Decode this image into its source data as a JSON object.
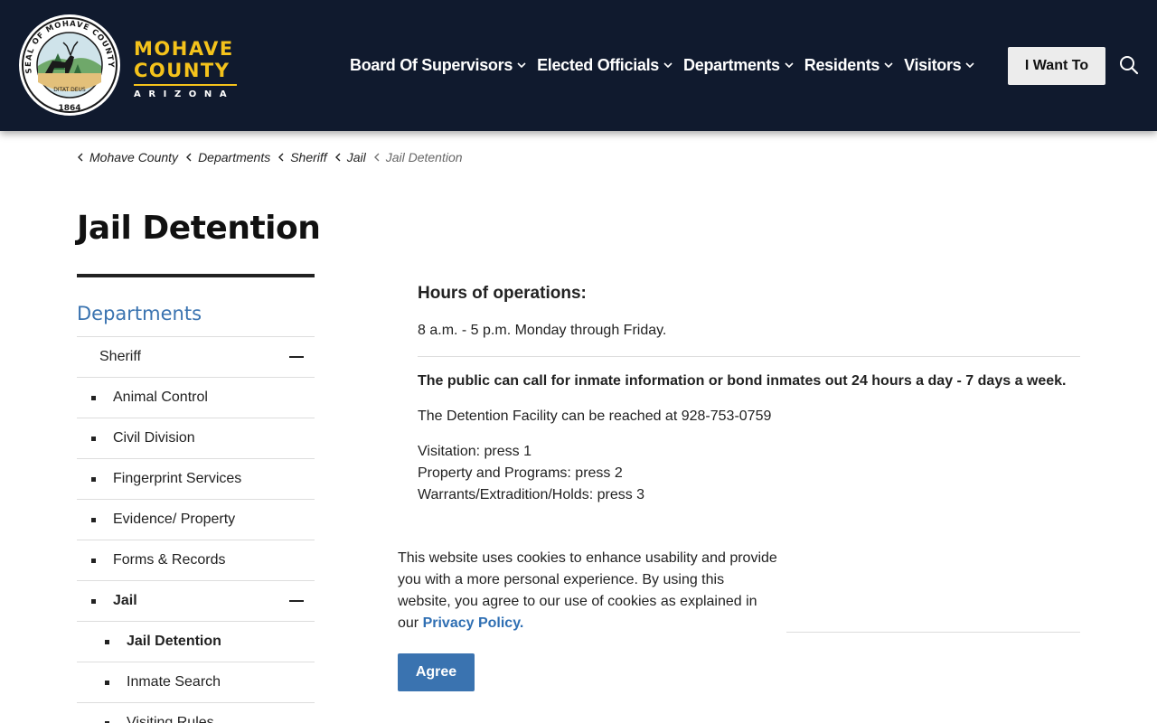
{
  "header": {
    "logo": {
      "seal_ring_text": "SEAL OF MOHAVE COUNTY ARIZONA",
      "seal_motto": "DITAT DEUS",
      "seal_year": "1864",
      "line1": "MOHAVE",
      "line2": "COUNTY",
      "line3": "ARIZONA"
    },
    "nav": [
      {
        "label": "Board Of Supervisors"
      },
      {
        "label": "Elected Officials"
      },
      {
        "label": "Departments"
      },
      {
        "label": "Residents"
      },
      {
        "label": "Visitors"
      }
    ],
    "i_want_to": "I Want To",
    "colors": {
      "header_bg": "#101a2e",
      "brand_gold": "#f4c21b",
      "link_blue": "#3a73b0"
    }
  },
  "breadcrumb": [
    {
      "label": "Mohave County"
    },
    {
      "label": "Departments"
    },
    {
      "label": "Sheriff"
    },
    {
      "label": "Jail"
    },
    {
      "label": "Jail Detention",
      "current": true
    }
  ],
  "page_title": "Jail Detention",
  "sidebar": {
    "heading": "Departments",
    "items": [
      {
        "label": "Sheriff",
        "level": 0,
        "expanded": true
      },
      {
        "label": "Animal Control",
        "level": 1
      },
      {
        "label": "Civil Division",
        "level": 1
      },
      {
        "label": "Fingerprint Services",
        "level": 1
      },
      {
        "label": "Evidence/ Property",
        "level": 1
      },
      {
        "label": "Forms & Records",
        "level": 1
      },
      {
        "label": "Jail",
        "level": 1,
        "expanded": true,
        "active": true
      },
      {
        "label": "Jail Detention",
        "level": 2,
        "active": true
      },
      {
        "label": "Inmate Search",
        "level": 2
      },
      {
        "label": "Visiting Rules",
        "level": 2
      }
    ]
  },
  "content": {
    "hours_title": "Hours of operations:",
    "hours_text": "8 a.m. - 5 p.m. Monday through Friday.",
    "bold_notice": "The public can call for inmate information or bond inmates out 24 hours a day - 7 days a week.",
    "reach_text": "The Detention Facility can be reached at 928-753-0759",
    "options": [
      "Visitation: press 1",
      "Property and Programs: press 2",
      "Warrants/Extradition/Holds: press 3"
    ]
  },
  "cookie": {
    "text": "This website uses cookies to enhance usability and provide you with a more personal experience. By using this website, you agree to our use of cookies as explained in our ",
    "link_text": "Privacy Policy.",
    "agree_label": "Agree"
  }
}
